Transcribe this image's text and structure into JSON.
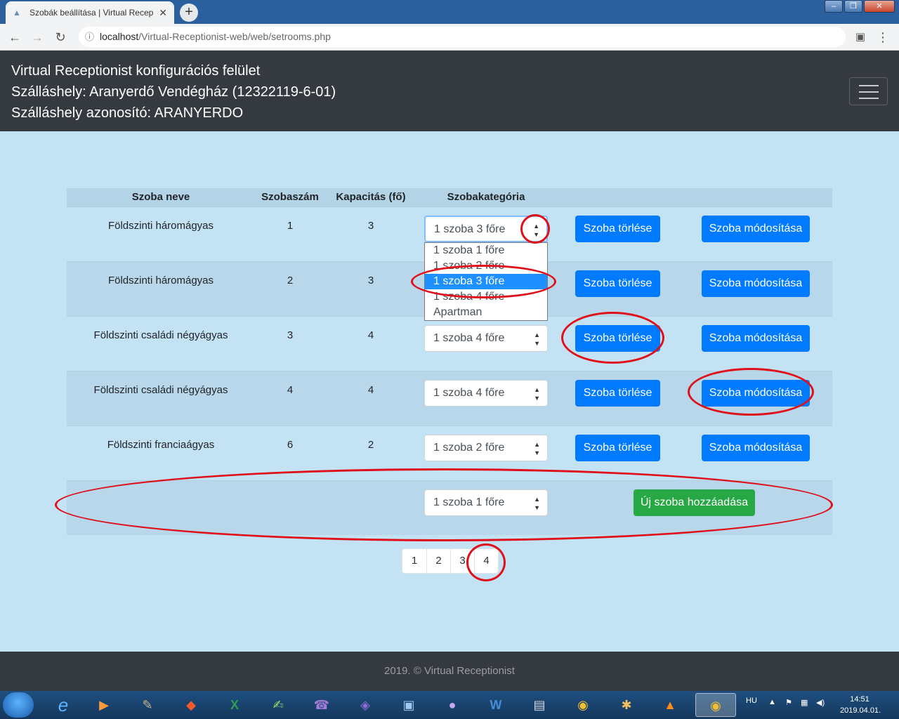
{
  "browser": {
    "tab_title": "Szobák beállítása | Virtual Recept",
    "tab_close": "✕",
    "new_tab": "+",
    "url_host": "localhost",
    "url_path": "/Virtual-Receptionist-web/web/setrooms.php",
    "window_controls": [
      "–",
      "❐",
      "✕"
    ]
  },
  "header": {
    "line1": "Virtual Receptionist konfigurációs felület",
    "line2": "Szálláshely: Aranyerdő Vendégház (12322119-6-01)",
    "line3": "Szálláshely azonosító: ARANYERDO"
  },
  "table": {
    "headers": [
      "Szoba neve",
      "Szobaszám",
      "Kapacitás (fő)",
      "Szobakategória"
    ],
    "rows": [
      {
        "name": "Földszinti háromágyas",
        "number": "1",
        "capacity": "3",
        "category": "1 szoba 3 főre"
      },
      {
        "name": "Földszinti háromágyas",
        "number": "2",
        "capacity": "3",
        "category": "1 szoba 3 főre"
      },
      {
        "name": "Földszinti családi négyágyas",
        "number": "3",
        "capacity": "4",
        "category": "1 szoba 4 főre"
      },
      {
        "name": "Földszinti családi négyágyas",
        "number": "4",
        "capacity": "4",
        "category": "1 szoba 4 főre"
      },
      {
        "name": "Földszinti franciaágyas",
        "number": "6",
        "capacity": "2",
        "category": "1 szoba 2 főre"
      }
    ],
    "delete_label": "Szoba törlése",
    "modify_label": "Szoba módosítása",
    "new_row": {
      "category": "1 szoba 1 főre",
      "add_label": "Új szoba hozzáadása"
    }
  },
  "dropdown": {
    "options": [
      "1 szoba 1 főre",
      "1 szoba 2 főre",
      "1 szoba 3 főre",
      "1 szoba 4 főre",
      "Apartman"
    ],
    "selected": "1 szoba 3 főre"
  },
  "pagination": [
    "1",
    "2",
    "3",
    "4"
  ],
  "footer": "2019. © Virtual Receptionist",
  "taskbar": {
    "lang": "HU",
    "time": "14:51",
    "date": "2019.04.01.",
    "apps": [
      "internet-explorer",
      "media-player",
      "gimp",
      "git",
      "excel",
      "notepad-plus",
      "viber",
      "visual-studio",
      "virtualbox",
      "github-desktop",
      "word",
      "save",
      "chrome",
      "paint",
      "vlc",
      "chrome-active"
    ]
  },
  "colors": {
    "primary": "#007bff",
    "success": "#28a745",
    "dark": "#343a40",
    "page_bg": "#c3e2f4",
    "annotation": "#e0101a"
  }
}
